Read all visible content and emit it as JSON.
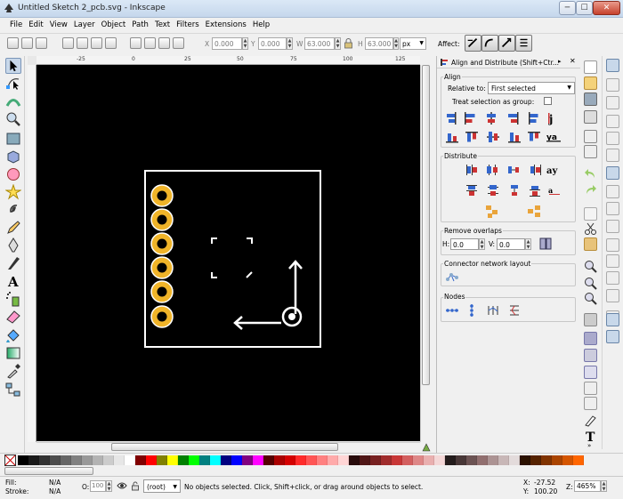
{
  "window": {
    "title": "Untitled Sketch 2_pcb.svg - Inkscape",
    "minimize": "─",
    "maximize": "☐",
    "close": "✕"
  },
  "menu": [
    "File",
    "Edit",
    "View",
    "Layer",
    "Object",
    "Path",
    "Text",
    "Filters",
    "Extensions",
    "Help"
  ],
  "controls": {
    "x_label": "X",
    "x_value": "0.000",
    "y_label": "Y",
    "y_value": "0.000",
    "w_label": "W",
    "w_value": "63.000",
    "h_label": "H",
    "h_value": "63.000",
    "unit": "px",
    "affect_label": "Affect:"
  },
  "ruler": {
    "h_ticks": [
      "-25",
      "0",
      "25",
      "50",
      "75",
      "100",
      "125"
    ]
  },
  "dock": {
    "title": "Align and Distribute (Shift+Ctr...",
    "align_title": "Align",
    "relative_to_label": "Relative to:",
    "relative_to_value": "First selected",
    "treat_group_label": "Treat selection as group:",
    "distribute_title": "Distribute",
    "remove_overlaps_title": "Remove overlaps",
    "h_label": "H:",
    "h_value": "0.0",
    "v_label": "V:",
    "v_value": "0.0",
    "connector_title": "Connector network layout",
    "nodes_title": "Nodes"
  },
  "palette": [
    "#000000",
    "#1a1a1a",
    "#333333",
    "#4d4d4d",
    "#666666",
    "#808080",
    "#999999",
    "#b3b3b3",
    "#cccccc",
    "#e6e6e6",
    "#ffffff",
    "#800000",
    "#ff0000",
    "#808000",
    "#ffff00",
    "#008000",
    "#00ff00",
    "#008080",
    "#00ffff",
    "#000080",
    "#0000ff",
    "#800080",
    "#ff00ff",
    "#550000",
    "#aa0000",
    "#d40000",
    "#ff2a2a",
    "#ff5555",
    "#ff8080",
    "#ffaaaa",
    "#ffd5d5",
    "#280b0b",
    "#501616",
    "#782121",
    "#a02c2c",
    "#c83737",
    "#d35f5f",
    "#de8787",
    "#e9afaf",
    "#f4d7d7",
    "#241c1c",
    "#483737",
    "#6c5353",
    "#916f6f",
    "#ac9393",
    "#c8b7b7",
    "#e3dbdb",
    "#2b1100",
    "#552200",
    "#803300",
    "#aa4400",
    "#d45500",
    "#ff6600"
  ],
  "status": {
    "fill_label": "Fill:",
    "fill_value": "N/A",
    "stroke_label": "Stroke:",
    "stroke_value": "N/A",
    "opacity_label": "O:",
    "opacity_value": "100",
    "layer": "(root)",
    "message": "No objects selected. Click, Shift+click, or drag around objects to select.",
    "x_label": "X:",
    "x_value": "-27.52",
    "y_label": "Y:",
    "y_value": "100.20",
    "zoom_label": "Z:",
    "zoom_value": "465%"
  },
  "colors": {
    "pad_gold": "#f0b429",
    "canvas_bg": "#000000",
    "board_stroke": "#ffffff"
  }
}
